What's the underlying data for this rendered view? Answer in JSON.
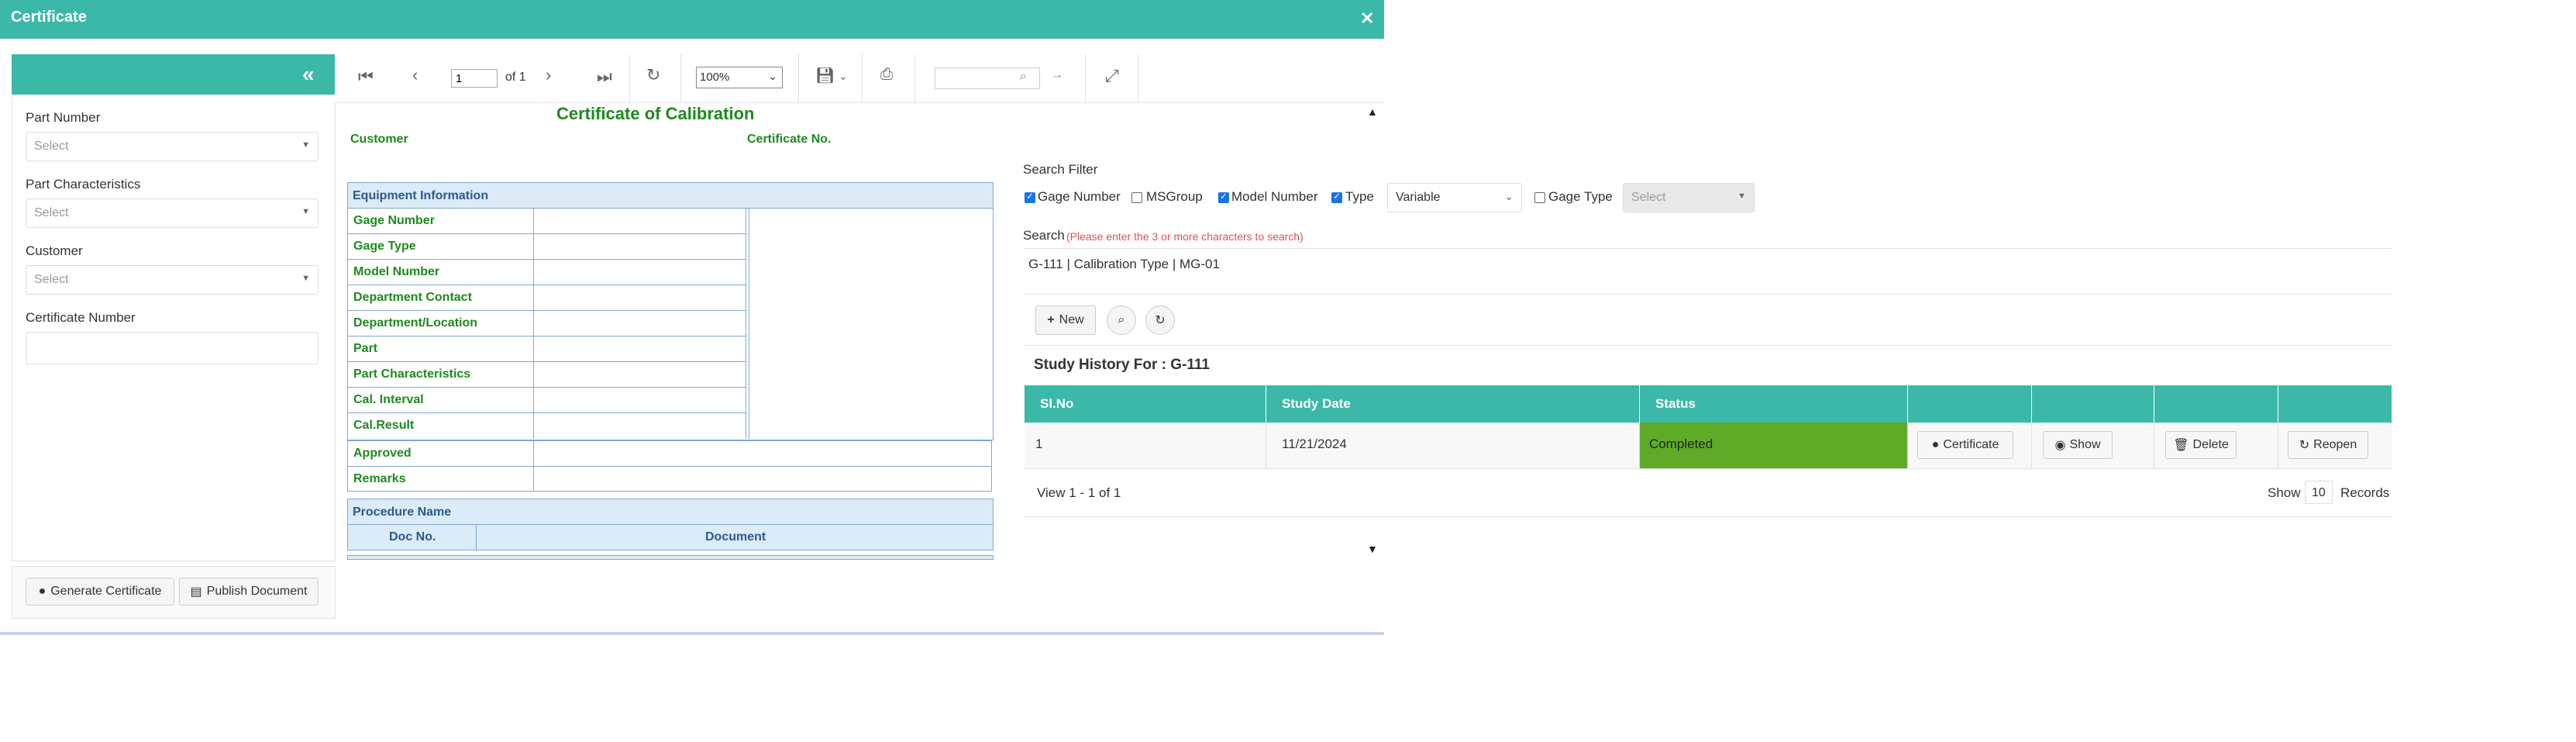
{
  "modal": {
    "title": "Certificate",
    "close_glyph": "✕"
  },
  "left_panel": {
    "fields": [
      {
        "label": "Part Number",
        "placeholder": "Select"
      },
      {
        "label": "Part Characteristics",
        "placeholder": "Select"
      },
      {
        "label": "Customer",
        "placeholder": "Select"
      },
      {
        "label": "Certificate Number",
        "value": ""
      }
    ],
    "generate_label": "Generate Certificate",
    "publish_label": "Publish Document"
  },
  "viewer_toolbar": {
    "page_value": "1",
    "of_pages": "of 1",
    "zoom": "100%"
  },
  "report": {
    "title": "Certificate of Calibration",
    "customer_label": "Customer",
    "cert_no_label": "Certificate No.",
    "equipment_heading": "Equipment Information",
    "equipment_rows": [
      "Gage Number",
      "Gage Type",
      "Model Number",
      "Department Contact",
      "Department/Location",
      "Part",
      "Part Characteristics",
      "Cal. Interval",
      "Cal.Result"
    ],
    "approved_label": "Approved",
    "remarks_label": "Remarks",
    "procedure_heading": "Procedure Name",
    "doc_no_col": "Doc No.",
    "document_col": "Document"
  },
  "search_filter": {
    "heading": "Search Filter",
    "options": [
      {
        "label": "Gage Number",
        "checked": true
      },
      {
        "label": "MSGroup",
        "checked": false
      },
      {
        "label": "Model Number",
        "checked": true
      },
      {
        "label": "Type",
        "checked": true
      }
    ],
    "type_value": "Variable",
    "gage_type_label": "Gage Type",
    "gage_type_checked": false,
    "gage_type_placeholder": "Select",
    "search_label": "Search",
    "search_hint": "(Please enter the 3 or more characters to search)",
    "search_value": "G-111 | Calibration Type | MG-01",
    "new_label": "New"
  },
  "history": {
    "title": "Study History For : G-111",
    "columns": [
      "Sl.No",
      "Study Date",
      "Status",
      "",
      "",
      "",
      ""
    ],
    "rows": [
      {
        "sl": "1",
        "date": "11/21/2024",
        "status": "Completed",
        "certificate": "Certificate",
        "show": "Show",
        "delete": "Delete",
        "reopen": "Reopen"
      }
    ],
    "view_text": "View 1 - 1 of 1",
    "show_label": "Show",
    "show_count": "10",
    "records_label": "Records"
  },
  "colors": {
    "teal": "#3bb8a8",
    "completed_green": "#5fab27",
    "report_green": "#1e8a1e",
    "hint_red": "#e05050"
  }
}
